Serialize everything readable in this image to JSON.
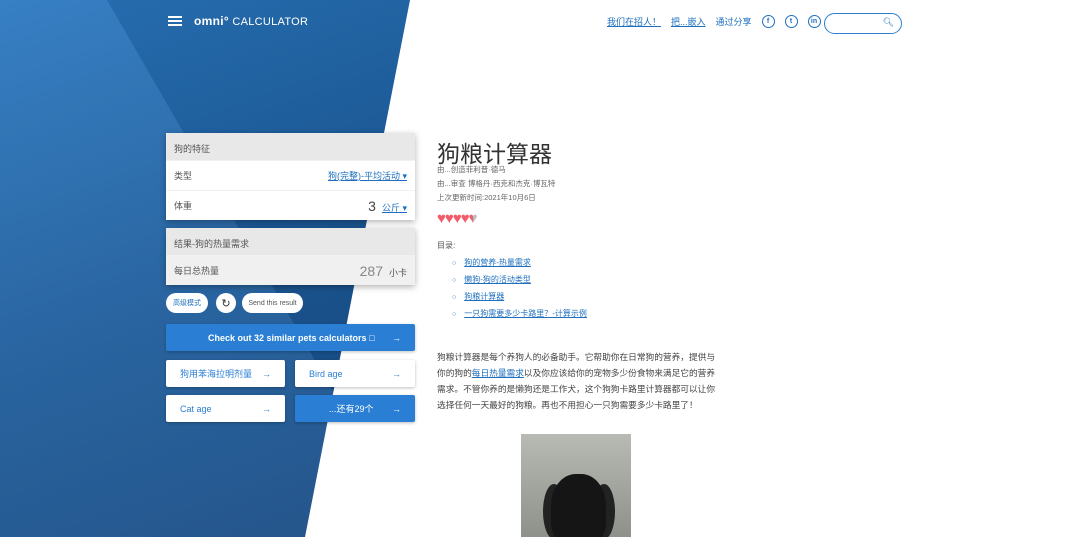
{
  "header": {
    "logo_bold": "omni°",
    "logo_text": "CALCULATOR",
    "hiring": "我们在招人！",
    "embed": "把...嵌入",
    "share": "通过分享",
    "social": [
      "f",
      "t",
      "in"
    ]
  },
  "card1": {
    "title": "狗的特征",
    "type_label": "类型",
    "type_value": "狗(完整)-平均活动 ▾",
    "weight_label": "体重",
    "weight_value": "3",
    "weight_unit": "公斤 ▾"
  },
  "card2": {
    "title": "结果-狗的热量需求",
    "kcal_label": "每日总热量",
    "kcal_value": "287",
    "kcal_unit": "小卡"
  },
  "actions": {
    "advanced": "高级模式",
    "reload": "↻",
    "send": "Send this result"
  },
  "similar": {
    "main": "Check out 32 similar pets calculators □",
    "items": [
      "狗用苯海拉明剂量",
      "Bird age",
      "Cat age",
      "...还有29个"
    ],
    "arrow": "→"
  },
  "article": {
    "title": "狗粮计算器",
    "author": "由...创造菲利普·德马",
    "reviewer": "由...审查 博格丹·西克和杰克·博瓦特",
    "updated": "上次更新时间:2021年10月6日",
    "rating": 4.5,
    "toc_label": "目录:",
    "toc": [
      "狗的营养-热量需求",
      "懒狗-狗的活动类型",
      "狗粮计算器",
      "一只狗需要多少卡路里？-计算示例"
    ],
    "p_before": "狗粮计算器是每个养狗人的必备助手。它帮助你在日常狗的营养，提供与你的狗的",
    "p_link": "每日热量需求",
    "p_after": "以及你应该给你的宠物多少份食物来满足它的营养需求。不管你养的是懒狗还是工作犬，这个狗狗卡路里计算器都可以让你选择任何一天最好的狗粮。再也不用担心一只狗需要多少卡路里了！"
  }
}
